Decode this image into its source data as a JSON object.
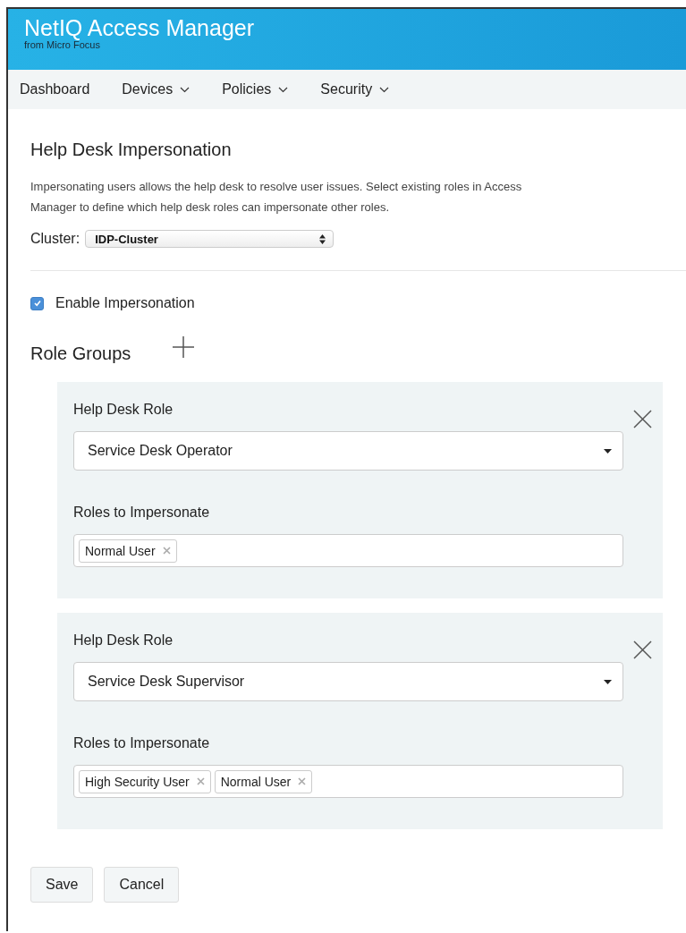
{
  "header": {
    "title": "NetIQ Access Manager",
    "subtitle": "from Micro Focus"
  },
  "nav": [
    {
      "label": "Dashboard",
      "has_menu": false
    },
    {
      "label": "Devices",
      "has_menu": true
    },
    {
      "label": "Policies",
      "has_menu": true
    },
    {
      "label": "Security",
      "has_menu": true
    }
  ],
  "page": {
    "title": "Help Desk Impersonation",
    "description": "Impersonating users allows the help desk to resolve user issues. Select existing roles in Access Manager to define which help desk roles can impersonate other roles.",
    "cluster_label": "Cluster:",
    "cluster_value": "IDP-Cluster"
  },
  "enable": {
    "label": "Enable Impersonation",
    "checked": true
  },
  "role_groups": {
    "title": "Role Groups",
    "groups": [
      {
        "role_label": "Help Desk Role",
        "role_value": "Service Desk Operator",
        "targets_label": "Roles to Impersonate",
        "targets": [
          "Normal User"
        ]
      },
      {
        "role_label": "Help Desk Role",
        "role_value": "Service Desk Supervisor",
        "targets_label": "Roles to Impersonate",
        "targets": [
          "High Security User",
          "Normal User"
        ]
      }
    ]
  },
  "buttons": [
    "Save",
    "Cancel"
  ]
}
